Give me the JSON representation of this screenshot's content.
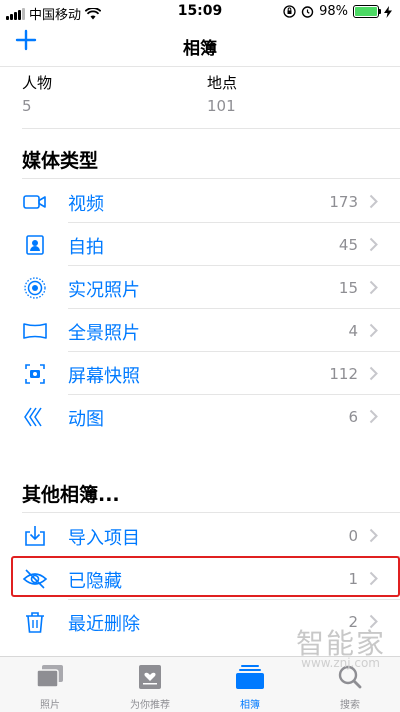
{
  "status_bar": {
    "carrier": "中国移动",
    "time": "15:09",
    "battery": "98%",
    "battery_level": 0.98
  },
  "nav": {
    "title": "相簿",
    "add_icon": "plus-icon"
  },
  "people_places": [
    {
      "label": "人物",
      "count": "5"
    },
    {
      "label": "地点",
      "count": "101"
    }
  ],
  "media_types": {
    "title": "媒体类型",
    "items": [
      {
        "label": "视频",
        "count": "173",
        "icon": "video-icon"
      },
      {
        "label": "自拍",
        "count": "45",
        "icon": "selfie-icon"
      },
      {
        "label": "实况照片",
        "count": "15",
        "icon": "live-photo-icon"
      },
      {
        "label": "全景照片",
        "count": "4",
        "icon": "panorama-icon"
      },
      {
        "label": "屏幕快照",
        "count": "112",
        "icon": "screenshot-icon"
      },
      {
        "label": "动图",
        "count": "6",
        "icon": "animated-icon"
      }
    ]
  },
  "other_albums": {
    "title": "其他相簿...",
    "items": [
      {
        "label": "导入项目",
        "count": "0",
        "icon": "import-icon"
      },
      {
        "label": "已隐藏",
        "count": "1",
        "icon": "hidden-eye-icon"
      },
      {
        "label": "最近删除",
        "count": "2",
        "icon": "trash-icon"
      }
    ]
  },
  "tabs": [
    {
      "label": "照片",
      "icon": "photos-tab-icon",
      "active": false
    },
    {
      "label": "为你推荐",
      "icon": "for-you-tab-icon",
      "active": false
    },
    {
      "label": "相簿",
      "icon": "albums-tab-icon",
      "active": true
    },
    {
      "label": "搜索",
      "icon": "search-tab-icon",
      "active": false
    }
  ],
  "watermark": {
    "text": "智能家",
    "url": "www.znj.com"
  },
  "colors": {
    "accent": "#007aff",
    "highlight": "#e02020",
    "secondary_text": "#8e8e93"
  }
}
